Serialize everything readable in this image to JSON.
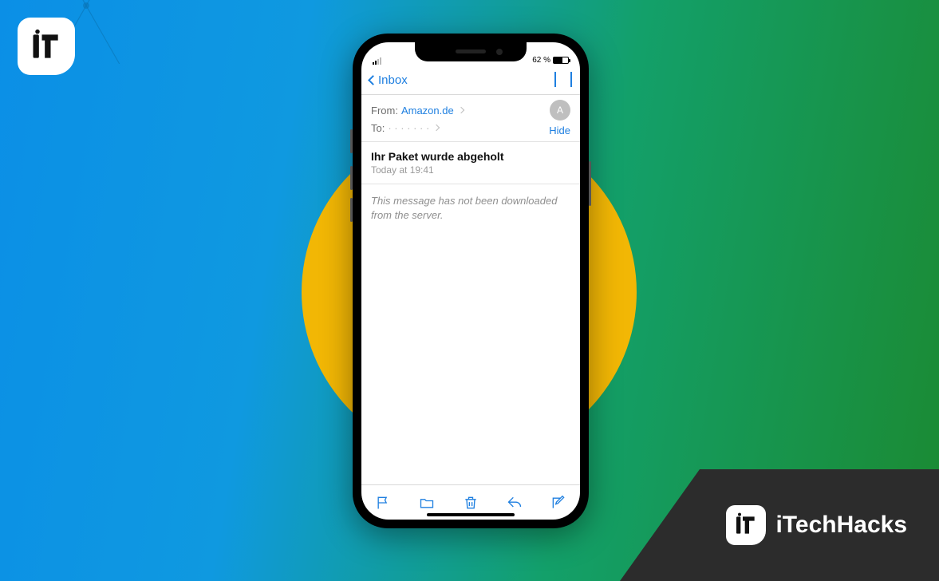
{
  "brand": {
    "name": "iTechHacks"
  },
  "status": {
    "battery_pct": "62 %"
  },
  "nav": {
    "back_label": "Inbox"
  },
  "email": {
    "from_label": "From:",
    "from_value": "Amazon.de",
    "to_label": "To:",
    "to_value": "· · · · · · ·",
    "hide_label": "Hide",
    "avatar_initial": "A",
    "subject": "Ihr Paket wurde abgeholt",
    "timestamp": "Today at 19:41",
    "body_text": "This message has not been downloaded from the server."
  },
  "toolbar": {
    "flag": "flag-icon",
    "folder": "folder-icon",
    "trash": "trash-icon",
    "reply": "reply-icon",
    "compose": "compose-icon"
  }
}
